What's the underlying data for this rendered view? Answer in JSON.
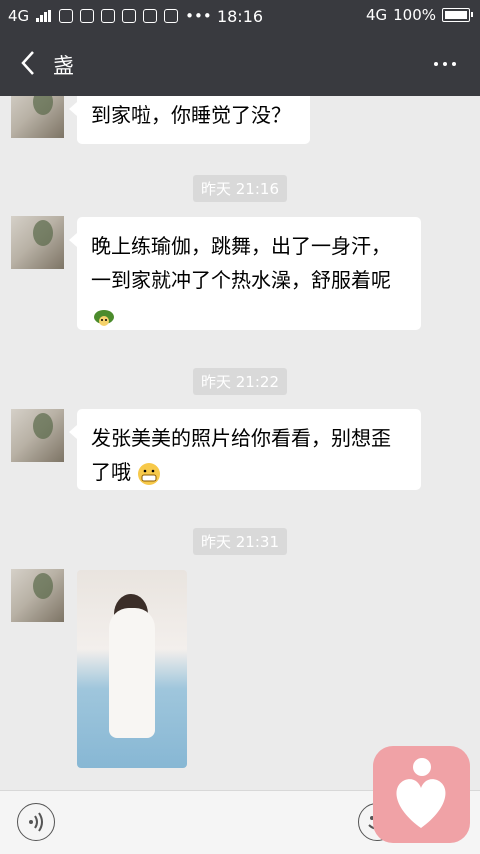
{
  "status_bar": {
    "network": "4G",
    "time": "18:16",
    "network_right": "4G",
    "battery": "100%"
  },
  "nav": {
    "title": "盏"
  },
  "messages": [
    {
      "text": "到家啦，你睡觉了没？"
    },
    {
      "timestamp": "昨天 21:16"
    },
    {
      "line1": "晚上练瑜伽，跳舞，出了一身汗，",
      "line2": "一到家就冲了个热水澡，舒服着呢"
    },
    {
      "timestamp": "昨天 21:22"
    },
    {
      "line1": "发张美美的照片给你看看，别想歪",
      "line2": "了哦"
    },
    {
      "timestamp": "昨天 21:31"
    }
  ],
  "icons": {
    "back": "chevron-left-icon",
    "more": "more-dots-icon",
    "voice": "voice-icon",
    "emoji": "emoji-icon",
    "floating": "heart-person-icon"
  },
  "colors": {
    "header": "#393a3f",
    "chat_bg": "#ebebeb",
    "floating_button": "#f0a2a6"
  }
}
